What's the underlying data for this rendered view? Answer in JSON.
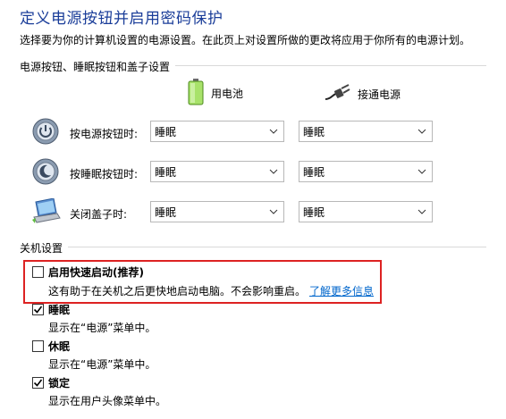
{
  "header": {
    "title": "定义电源按钮并启用密码保护",
    "description": "选择要为你的计算机设置的电源设置。在此页上对设置所做的更改将应用于你所有的电源计划。"
  },
  "power_section": {
    "title": "电源按钮、睡眠按钮和盖子设置",
    "columns": {
      "battery": "用电池",
      "plugged": "接通电源"
    },
    "rows": [
      {
        "label": "按电源按钮时:",
        "battery": "睡眠",
        "plugged": "睡眠",
        "icon": "power-button-icon"
      },
      {
        "label": "按睡眠按钮时:",
        "battery": "睡眠",
        "plugged": "睡眠",
        "icon": "sleep-button-icon"
      },
      {
        "label": "关闭盖子时:",
        "battery": "睡眠",
        "plugged": "睡眠",
        "icon": "laptop-lid-icon"
      }
    ]
  },
  "shutdown_section": {
    "title": "关机设置",
    "options": [
      {
        "label": "启用快速启动(推荐)",
        "checked": false,
        "description": "这有助于在关机之后更快地启动电脑。不会影响重启。",
        "link": "了解更多信息"
      },
      {
        "label": "睡眠",
        "checked": true,
        "description": "显示在“电源”菜单中。"
      },
      {
        "label": "休眠",
        "checked": false,
        "description": "显示在“电源”菜单中。"
      },
      {
        "label": "锁定",
        "checked": true,
        "description": "显示在用户头像菜单中。"
      }
    ]
  },
  "colors": {
    "title": "#1a3d99",
    "link": "#0066cc",
    "highlight": "#dd2222"
  }
}
